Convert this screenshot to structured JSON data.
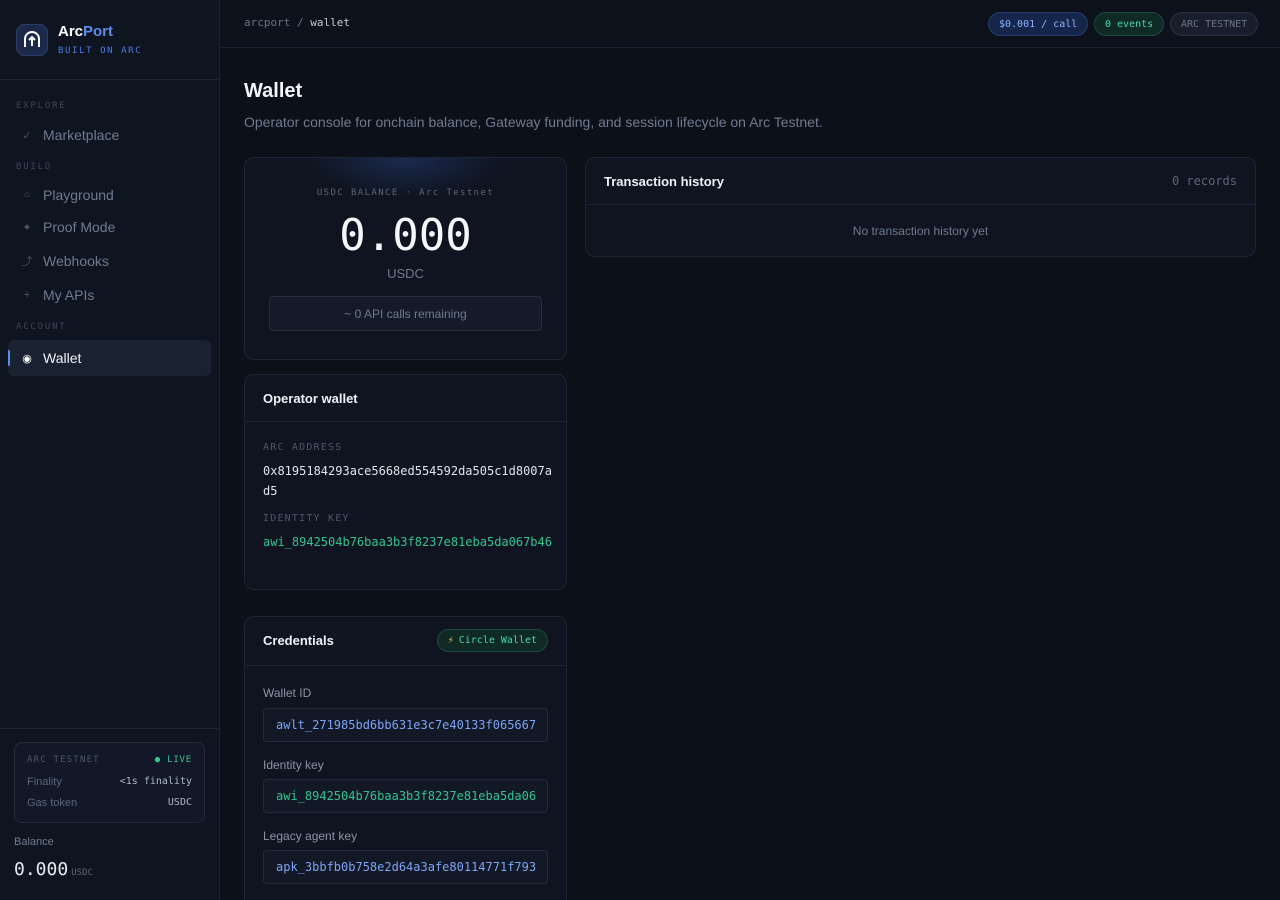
{
  "brand": {
    "name_a": "Arc",
    "name_b": "Port",
    "subtitle": "BUILT ON ARC"
  },
  "nav": {
    "sections": {
      "explore": "EXPLORE",
      "build": "BUILD",
      "account": "ACCOUNT"
    },
    "items": [
      {
        "label": "Marketplace",
        "icon": "check-icon"
      },
      {
        "label": "Playground",
        "icon": "circle-icon"
      },
      {
        "label": "Proof Mode",
        "icon": "sparkle-icon"
      },
      {
        "label": "Webhooks",
        "icon": "curve-arrow-icon"
      },
      {
        "label": "My APIs",
        "icon": "plus-icon"
      },
      {
        "label": "Wallet",
        "icon": "wallet-dot-icon",
        "active": true
      }
    ]
  },
  "network": {
    "title": "ARC TESTNET",
    "status": "● LIVE",
    "finality_label": "Finality",
    "finality_value": "<1s finality",
    "gas_label": "Gas token",
    "gas_value": "USDC"
  },
  "sidebar_balance": {
    "label": "Balance",
    "value": "0.000",
    "unit": "USDC"
  },
  "topbar": {
    "crumb_root": "arcport",
    "crumb_sep": "/",
    "crumb_current": "wallet",
    "price_pill": "$0.001 / call",
    "events_pill": "0 events",
    "network_pill": "ARC TESTNET"
  },
  "page": {
    "title": "Wallet",
    "subtitle": "Operator console for onchain balance, Gateway funding, and session lifecycle on Arc Testnet."
  },
  "balance": {
    "label": "USDC BALANCE · Arc Testnet",
    "value": "0.000",
    "unit": "USDC",
    "calls": "~ 0 API calls remaining"
  },
  "operator": {
    "title": "Operator wallet",
    "address_label": "ARC ADDRESS",
    "address": "0x8195184293ace5668ed554592da505c1d8007ad5",
    "identity_label": "IDENTITY KEY",
    "identity": "awi_8942504b76baa3b3f8237e81eba5da067b46"
  },
  "credentials": {
    "title": "Credentials",
    "badge": "Circle Wallet",
    "wallet_id_label": "Wallet ID",
    "wallet_id": "awlt_271985bd6bb631e3c7e40133f065667",
    "identity_label": "Identity key",
    "identity": "awi_8942504b76baa3b3f8237e81eba5da06",
    "legacy_label": "Legacy agent key",
    "legacy": "apk_3bbfb0b758e2d64a3afe80114771f793"
  },
  "transactions": {
    "title": "Transaction history",
    "count": "0 records",
    "empty": "No transaction history yet"
  },
  "colors": {
    "accent": "#5b8def",
    "success": "#34c38f",
    "background": "#0c1019"
  }
}
